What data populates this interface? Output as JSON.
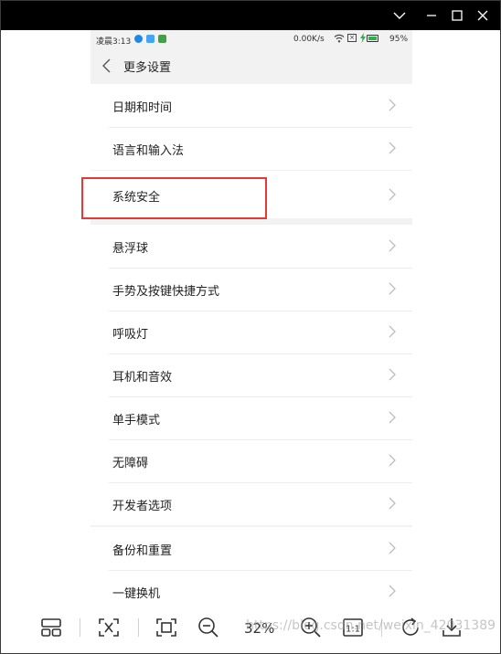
{
  "window": {
    "controls": [
      "chevron-down-icon",
      "minimize-icon",
      "maximize-icon",
      "close-icon"
    ]
  },
  "status_bar": {
    "time": "凌晨3:13",
    "network_speed": "0.00K/s",
    "battery_percent": "95%",
    "colors": {
      "dot1": "#1e88e5",
      "dot2": "#42a5f5",
      "dot3": "#43a047",
      "battery": "#2bb24c"
    }
  },
  "header": {
    "title": "更多设置"
  },
  "settings": {
    "group1": [
      {
        "label": "日期和时间"
      },
      {
        "label": "语言和输入法"
      }
    ],
    "group2": [
      {
        "label": "系统安全"
      }
    ],
    "group3": [
      {
        "label": "悬浮球"
      },
      {
        "label": "手势及按键快捷方式"
      },
      {
        "label": "呼吸灯"
      },
      {
        "label": "耳机和音效"
      },
      {
        "label": "单手模式"
      },
      {
        "label": "无障碍"
      },
      {
        "label": "开发者选项"
      }
    ],
    "group4": [
      {
        "label": "备份和重置"
      },
      {
        "label": "一键换机"
      }
    ]
  },
  "highlight": {
    "color": "#e53935",
    "target": "系统安全"
  },
  "toolbar": {
    "zoom": "32%",
    "actual_size_label": "1:1",
    "watermark": "https://blog.csdn.net/weixin_42031389"
  }
}
